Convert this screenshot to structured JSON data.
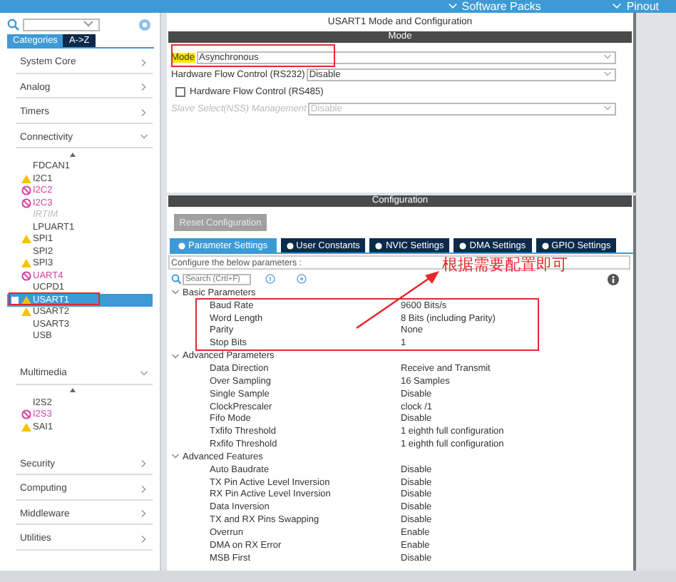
{
  "top_bar": {
    "menus": [
      {
        "label": "Software Packs"
      },
      {
        "label": "Pinout"
      }
    ]
  },
  "sidebar": {
    "tabs": [
      {
        "label": "Categories",
        "selected": true
      },
      {
        "label": "A->Z",
        "selected": false
      }
    ],
    "categories": [
      {
        "label": "System Core",
        "expanded": false
      },
      {
        "label": "Analog",
        "expanded": false
      },
      {
        "label": "Timers",
        "expanded": false
      },
      {
        "label": "Connectivity",
        "expanded": true,
        "items": [
          {
            "label": "FDCAN1",
            "kind": "plain",
            "selected": false,
            "annotated": false
          },
          {
            "label": "I2C1",
            "kind": "warning",
            "selected": false,
            "annotated": false
          },
          {
            "label": "I2C2",
            "kind": "error",
            "selected": false,
            "annotated": false
          },
          {
            "label": "I2C3",
            "kind": "error",
            "selected": false,
            "annotated": false
          },
          {
            "label": "IRTIM",
            "kind": "unavailable",
            "selected": false,
            "annotated": false
          },
          {
            "label": "LPUART1",
            "kind": "plain",
            "selected": false,
            "annotated": false
          },
          {
            "label": "SPI1",
            "kind": "warning",
            "selected": false,
            "annotated": false
          },
          {
            "label": "SPI2",
            "kind": "plain",
            "selected": false,
            "annotated": false
          },
          {
            "label": "SPI3",
            "kind": "warning",
            "selected": false,
            "annotated": false
          },
          {
            "label": "UART4",
            "kind": "error",
            "selected": false,
            "annotated": false
          },
          {
            "label": "UCPD1",
            "kind": "plain",
            "selected": false,
            "annotated": false
          },
          {
            "label": "USART1",
            "kind": "warning",
            "selected": true,
            "annotated": true
          },
          {
            "label": "USART2",
            "kind": "warning",
            "selected": false,
            "annotated": false
          },
          {
            "label": "USART3",
            "kind": "plain",
            "selected": false,
            "annotated": false
          },
          {
            "label": "USB",
            "kind": "plain",
            "selected": false,
            "annotated": false
          }
        ]
      },
      {
        "label": "Multimedia",
        "expanded": true,
        "items": [
          {
            "label": "I2S2",
            "kind": "plain",
            "selected": false,
            "annotated": false
          },
          {
            "label": "I2S3",
            "kind": "error",
            "selected": false,
            "annotated": false
          },
          {
            "label": "SAI1",
            "kind": "warning",
            "selected": false,
            "annotated": false
          }
        ]
      },
      {
        "label": "Security",
        "expanded": false
      },
      {
        "label": "Computing",
        "expanded": false
      },
      {
        "label": "Middleware",
        "expanded": false
      },
      {
        "label": "Utilities",
        "expanded": false
      }
    ]
  },
  "mode_panel": {
    "title": "USART1 Mode and Configuration",
    "header": "Mode",
    "fields": [
      {
        "kind": "select",
        "label": "Mode",
        "value": "Asynchronous",
        "highlighted": true,
        "disabled": false,
        "annotated": true
      },
      {
        "kind": "select",
        "label": "Hardware Flow Control (RS232)",
        "value": "Disable",
        "highlighted": false,
        "disabled": false,
        "annotated": false
      },
      {
        "kind": "checkbox",
        "label": "Hardware Flow Control (RS485)",
        "checked": false
      },
      {
        "kind": "select",
        "label": "Slave Select(NSS) Management",
        "value": "Disable",
        "highlighted": false,
        "disabled": true,
        "annotated": false
      }
    ]
  },
  "config_panel": {
    "header": "Configuration",
    "reset_button": {
      "label": "Reset Configuration",
      "disabled": true
    },
    "tabs": [
      {
        "label": "Parameter Settings",
        "selected": true
      },
      {
        "label": "User Constants",
        "selected": false
      },
      {
        "label": "NVIC Settings",
        "selected": false
      },
      {
        "label": "DMA Settings",
        "selected": false
      },
      {
        "label": "GPIO Settings",
        "selected": false
      }
    ],
    "description": "Configure the below parameters :",
    "search": {
      "placeholder": "Search (Crtl+F)"
    },
    "annotation": {
      "text": "根据需要配置即可"
    },
    "groups": [
      {
        "label": "Basic Parameters",
        "expanded": true,
        "annotated": true,
        "params": [
          {
            "name": "Baud Rate",
            "value": "9600 Bits/s"
          },
          {
            "name": "Word Length",
            "value": "8 Bits (including Parity)"
          },
          {
            "name": "Parity",
            "value": "None"
          },
          {
            "name": "Stop Bits",
            "value": "1"
          }
        ]
      },
      {
        "label": "Advanced Parameters",
        "expanded": true,
        "annotated": false,
        "params": [
          {
            "name": "Data Direction",
            "value": "Receive and Transmit"
          },
          {
            "name": "Over Sampling",
            "value": "16 Samples"
          },
          {
            "name": "Single Sample",
            "value": "Disable"
          },
          {
            "name": "ClockPrescaler",
            "value": "clock /1"
          },
          {
            "name": "Fifo Mode",
            "value": "Disable"
          },
          {
            "name": "Txfifo Threshold",
            "value": "1 eighth full configuration"
          },
          {
            "name": "Rxfifo Threshold",
            "value": "1 eighth full configuration"
          }
        ]
      },
      {
        "label": "Advanced Features",
        "expanded": true,
        "annotated": false,
        "params": [
          {
            "name": "Auto Baudrate",
            "value": "Disable"
          },
          {
            "name": "TX Pin Active Level Inversion",
            "value": "Disable"
          },
          {
            "name": "RX Pin Active Level Inversion",
            "value": "Disable"
          },
          {
            "name": "Data Inversion",
            "value": "Disable"
          },
          {
            "name": "TX and RX Pins Swapping",
            "value": "Disable"
          },
          {
            "name": "Overrun",
            "value": "Enable"
          },
          {
            "name": "DMA on RX Error",
            "value": "Enable"
          },
          {
            "name": "MSB First",
            "value": "Disable"
          }
        ]
      }
    ]
  }
}
